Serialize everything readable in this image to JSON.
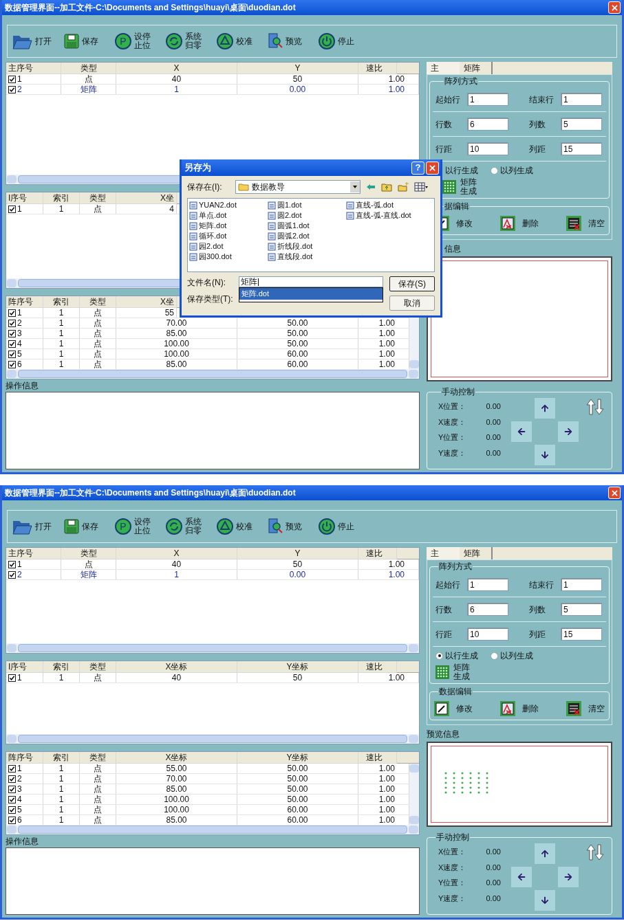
{
  "windows": [
    {
      "title": "数据管理界面--加工文件-C:\\Documents and Settings\\huayi\\桌面\\duodian.dot",
      "toolbar": [
        {
          "label": "打开",
          "kind": "open"
        },
        {
          "label": "保存",
          "kind": "save"
        },
        {
          "label": "设停止位",
          "kind": "glyph",
          "glyph": "P"
        },
        {
          "label": "系统归零",
          "kind": "home"
        },
        {
          "label": "校准",
          "kind": "calibrate"
        },
        {
          "label": "预览",
          "kind": "preview"
        },
        {
          "label": "停止",
          "kind": "stop"
        }
      ],
      "tables": [
        {
          "columns": [
            "主序号",
            "类型",
            "X",
            "Y",
            "速比"
          ],
          "rows": [
            {
              "checked": true,
              "selected": false,
              "cells": [
                "1",
                "点",
                "40",
                "50",
                "1.00"
              ]
            },
            {
              "checked": true,
              "selected": true,
              "cells": [
                "2",
                "矩阵",
                "1",
                "0.00",
                "1.00"
              ]
            }
          ]
        },
        {
          "columns": [
            "I序号",
            "索引",
            "类型",
            "X坐"
          ],
          "rows": [
            {
              "checked": true,
              "selected": false,
              "cells": [
                "1",
                "1",
                "点",
                "4"
              ]
            }
          ]
        },
        {
          "columns": [
            "阵序号",
            "索引",
            "类型",
            "X坐"
          ],
          "rows": [
            {
              "checked": true,
              "selected": false,
              "cells": [
                "1",
                "1",
                "点",
                "55"
              ]
            },
            {
              "checked": true,
              "selected": false,
              "cells": [
                "2",
                "1",
                "点",
                "70.00",
                "50.00",
                "1.00"
              ]
            },
            {
              "checked": true,
              "selected": false,
              "cells": [
                "3",
                "1",
                "点",
                "85.00",
                "50.00",
                "1.00"
              ]
            },
            {
              "checked": true,
              "selected": false,
              "cells": [
                "4",
                "1",
                "点",
                "100.00",
                "50.00",
                "1.00"
              ]
            },
            {
              "checked": true,
              "selected": false,
              "cells": [
                "5",
                "1",
                "点",
                "100.00",
                "60.00",
                "1.00"
              ]
            },
            {
              "checked": true,
              "selected": false,
              "cells": [
                "6",
                "1",
                "点",
                "85.00",
                "60.00",
                "1.00"
              ]
            }
          ]
        }
      ],
      "log_label": "操作信息",
      "right": {
        "tabs": [
          {
            "label": "主",
            "selected": false
          },
          {
            "label": "矩阵",
            "selected": true
          }
        ],
        "array_group": {
          "label": "阵列方式",
          "fields": [
            {
              "label": "起始行",
              "value": "1"
            },
            {
              "label": "结束行",
              "value": "1"
            },
            {
              "label": "行数",
              "value": "6"
            },
            {
              "label": "列数",
              "value": "5"
            },
            {
              "label": "行距",
              "value": "10"
            },
            {
              "label": "列距",
              "value": "15"
            }
          ],
          "radios": [
            {
              "label": "以行生成"
            },
            {
              "label": "以列生成",
              "selected": false
            }
          ],
          "generate_button": "矩阵生成"
        },
        "edit_group": {
          "label": "据编辑",
          "buttons": [
            {
              "label": "修改",
              "kind": "edit"
            },
            {
              "label": "删除",
              "kind": "delete"
            },
            {
              "label": "清空",
              "kind": "clear"
            }
          ]
        },
        "preview": {
          "label": "信息",
          "points_shown": false
        },
        "manual": {
          "label": "手动控制",
          "readings": [
            {
              "label": "X位置：",
              "value": "0.00"
            },
            {
              "label": "X速度：",
              "value": "0.00"
            },
            {
              "label": "Y位置：",
              "value": "0.00"
            },
            {
              "label": "Y速度：",
              "value": "0.00"
            }
          ]
        }
      },
      "dialog": {
        "title": "另存为",
        "help": "?",
        "location_label": "保存在(I):",
        "location": "数据教导",
        "files": [
          [
            "YUAN2.dot",
            "单点.dot",
            "矩阵.dot",
            "循环.dot",
            "园2.dot",
            "园300.dot"
          ],
          [
            "圆1.dot",
            "圆2.dot",
            "圆弧1.dot",
            "圆弧2.dot",
            "折线段.dot",
            "直线段.dot"
          ],
          [
            "直线-弧.dot",
            "直线-弧-直线.dot"
          ]
        ],
        "filename_label": "文件名(N):",
        "filename": "矩阵",
        "type_label": "保存类型(T):",
        "type_options": [
          {
            "label": "矩阵.dot",
            "selected": true
          }
        ],
        "buttons": [
          "保存(S)",
          "取消"
        ]
      }
    },
    {
      "title": "数据管理界面--加工文件-C:\\Documents and Settings\\huayi\\桌面\\duodian.dot",
      "toolbar": [
        {
          "label": "打开",
          "kind": "open"
        },
        {
          "label": "保存",
          "kind": "save"
        },
        {
          "label": "设停止位",
          "kind": "glyph",
          "glyph": "P"
        },
        {
          "label": "系统归零",
          "kind": "home"
        },
        {
          "label": "校准",
          "kind": "calibrate"
        },
        {
          "label": "预览",
          "kind": "preview"
        },
        {
          "label": "停止",
          "kind": "stop"
        }
      ],
      "tables": [
        {
          "columns": [
            "主序号",
            "类型",
            "X",
            "Y",
            "速比"
          ],
          "rows": [
            {
              "checked": true,
              "selected": false,
              "cells": [
                "1",
                "点",
                "40",
                "50",
                "1.00"
              ]
            },
            {
              "checked": true,
              "selected": true,
              "cells": [
                "2",
                "矩阵",
                "1",
                "0.00",
                "1.00"
              ]
            }
          ]
        },
        {
          "columns": [
            "I序号",
            "索引",
            "类型",
            "X坐标",
            "Y坐标",
            "速比"
          ],
          "rows": [
            {
              "checked": true,
              "selected": false,
              "cells": [
                "1",
                "1",
                "点",
                "40",
                "50",
                "1.00"
              ]
            }
          ]
        },
        {
          "columns": [
            "阵序号",
            "索引",
            "类型",
            "X坐标",
            "Y坐标",
            "速比"
          ],
          "rows": [
            {
              "checked": true,
              "selected": false,
              "cells": [
                "1",
                "1",
                "点",
                "55.00",
                "50.00",
                "1.00"
              ]
            },
            {
              "checked": true,
              "selected": false,
              "cells": [
                "2",
                "1",
                "点",
                "70.00",
                "50.00",
                "1.00"
              ]
            },
            {
              "checked": true,
              "selected": false,
              "cells": [
                "3",
                "1",
                "点",
                "85.00",
                "50.00",
                "1.00"
              ]
            },
            {
              "checked": true,
              "selected": false,
              "cells": [
                "4",
                "1",
                "点",
                "100.00",
                "50.00",
                "1.00"
              ]
            },
            {
              "checked": true,
              "selected": false,
              "cells": [
                "5",
                "1",
                "点",
                "100.00",
                "60.00",
                "1.00"
              ]
            },
            {
              "checked": true,
              "selected": false,
              "cells": [
                "6",
                "1",
                "点",
                "85.00",
                "60.00",
                "1.00"
              ]
            }
          ]
        }
      ],
      "log_label": "操作信息",
      "right": {
        "tabs": [
          {
            "label": "主",
            "selected": false
          },
          {
            "label": "矩阵",
            "selected": true
          }
        ],
        "array_group": {
          "label": "阵列方式",
          "fields": [
            {
              "label": "起始行",
              "value": "1"
            },
            {
              "label": "结束行",
              "value": "1"
            },
            {
              "label": "行数",
              "value": "6"
            },
            {
              "label": "列数",
              "value": "5"
            },
            {
              "label": "行距",
              "value": "10"
            },
            {
              "label": "列距",
              "value": "15"
            }
          ],
          "radios": [
            {
              "label": "以行生成",
              "selected": true
            },
            {
              "label": "以列生成",
              "selected": false
            }
          ],
          "generate_button": "矩阵生成"
        },
        "edit_group": {
          "label": "数据编辑",
          "buttons": [
            {
              "label": "修改",
              "kind": "edit"
            },
            {
              "label": "删除",
              "kind": "delete"
            },
            {
              "label": "清空",
              "kind": "clear"
            }
          ]
        },
        "preview": {
          "label": "预览信息",
          "points_shown": true
        },
        "manual": {
          "label": "手动控制",
          "readings": [
            {
              "label": "X位置：",
              "value": "0.00"
            },
            {
              "label": "X速度：",
              "value": "0.00"
            },
            {
              "label": "Y位置：",
              "value": "0.00"
            },
            {
              "label": "Y速度：",
              "value": "0.00"
            }
          ]
        }
      }
    }
  ]
}
